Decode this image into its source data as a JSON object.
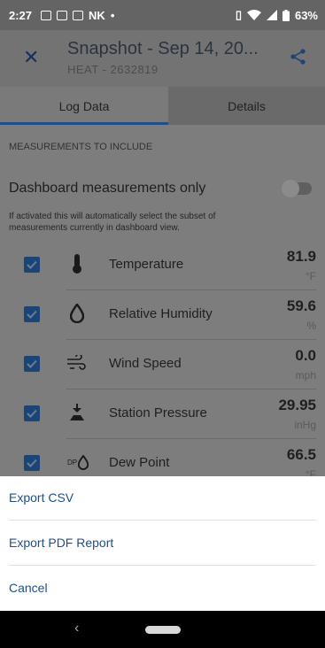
{
  "status_bar": {
    "time": "2:27",
    "carrier_tag": "NK",
    "battery": "63%"
  },
  "header": {
    "title": "Snapshot - Sep 14, 20...",
    "subtitle": "HEAT - 2632819"
  },
  "tabs": [
    {
      "label": "Log Data",
      "active": true
    },
    {
      "label": "Details",
      "active": false
    }
  ],
  "section_label": "MEASUREMENTS TO INCLUDE",
  "dashboard_toggle": {
    "label": "Dashboard measurements only",
    "on": false
  },
  "help_text": "If activated this will automatically select the subset of measurements currently in dashboard view.",
  "measurements": [
    {
      "name": "Temperature",
      "value": "81.9",
      "unit": "°F",
      "checked": true,
      "icon": "thermometer-icon"
    },
    {
      "name": "Relative Humidity",
      "value": "59.6",
      "unit": "%",
      "checked": true,
      "icon": "droplet-icon"
    },
    {
      "name": "Wind Speed",
      "value": "0.0",
      "unit": "mph",
      "checked": true,
      "icon": "wind-icon"
    },
    {
      "name": "Station Pressure",
      "value": "29.95",
      "unit": "inHg",
      "checked": true,
      "icon": "pressure-icon"
    },
    {
      "name": "Dew Point",
      "value": "66.5",
      "unit": "°F",
      "checked": true,
      "icon": "dew-point-icon",
      "icon_text": "DP"
    }
  ],
  "sheet": {
    "export_csv": "Export CSV",
    "export_pdf": "Export PDF Report",
    "cancel": "Cancel"
  },
  "colors": {
    "accent": "#1f4f86",
    "scrim_bg": "#7d7d7d",
    "sheet_bg": "#ffffff"
  }
}
